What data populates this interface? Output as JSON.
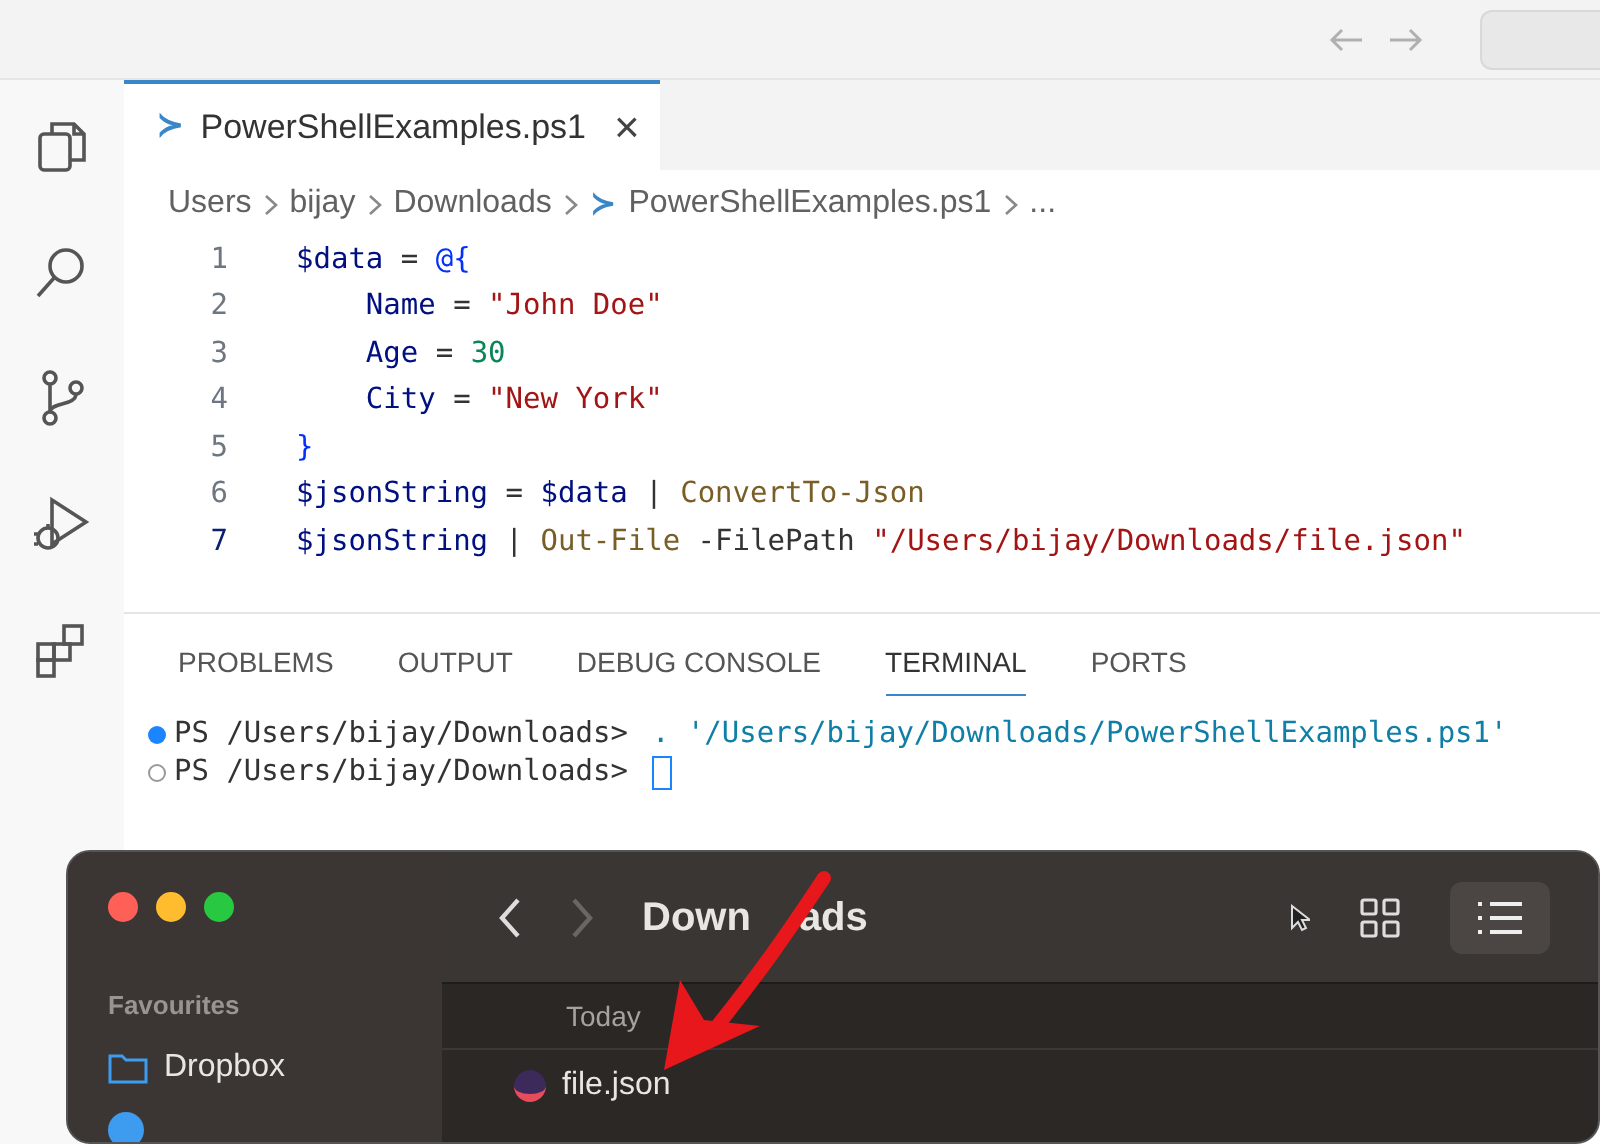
{
  "editor_tab": {
    "icon": "≻",
    "title": "PowerShellExamples.ps1",
    "close": "×"
  },
  "breadcrumbs": [
    {
      "text": "Users"
    },
    {
      "text": "bijay"
    },
    {
      "text": "Downloads"
    },
    {
      "text": "PowerShellExamples.ps1",
      "kind": "file"
    },
    {
      "text": "..."
    }
  ],
  "code_lines": [
    {
      "number": "1",
      "current": false,
      "tokens": [
        {
          "t": "$data",
          "color": "#001080"
        },
        {
          "t": " = ",
          "color": "#333333"
        },
        {
          "t": "@{",
          "color": "#0431fa"
        }
      ]
    },
    {
      "number": "2",
      "current": false,
      "tokens": [
        {
          "t": "    Name",
          "color": "#001080"
        },
        {
          "t": " = ",
          "color": "#333333"
        },
        {
          "t": "\"John Doe\"",
          "color": "#a31515"
        }
      ]
    },
    {
      "number": "3",
      "current": false,
      "tokens": [
        {
          "t": "    Age",
          "color": "#001080"
        },
        {
          "t": " = ",
          "color": "#333333"
        },
        {
          "t": "30",
          "color": "#098658"
        }
      ]
    },
    {
      "number": "4",
      "current": false,
      "tokens": [
        {
          "t": "    City",
          "color": "#001080"
        },
        {
          "t": " = ",
          "color": "#333333"
        },
        {
          "t": "\"New York\"",
          "color": "#a31515"
        }
      ]
    },
    {
      "number": "5",
      "current": false,
      "tokens": [
        {
          "t": "}",
          "color": "#0431fa"
        }
      ]
    },
    {
      "number": "6",
      "current": false,
      "tokens": [
        {
          "t": "$jsonString",
          "color": "#001080"
        },
        {
          "t": " = ",
          "color": "#333333"
        },
        {
          "t": "$data",
          "color": "#001080"
        },
        {
          "t": " | ",
          "color": "#333333"
        },
        {
          "t": "ConvertTo-Json",
          "color": "#795e26"
        }
      ]
    },
    {
      "number": "7",
      "current": true,
      "tokens": [
        {
          "t": "$jsonString",
          "color": "#001080"
        },
        {
          "t": " | ",
          "color": "#333333"
        },
        {
          "t": "Out-File",
          "color": "#795e26"
        },
        {
          "t": " -FilePath ",
          "color": "#333333"
        },
        {
          "t": "\"/Users/bijay/Downloads/file.json\"",
          "color": "#a31515"
        }
      ]
    }
  ],
  "panel_tabs": [
    {
      "label": "PROBLEMS",
      "selected": false
    },
    {
      "label": "OUTPUT",
      "selected": false
    },
    {
      "label": "DEBUG CONSOLE",
      "selected": false
    },
    {
      "label": "TERMINAL",
      "selected": true
    },
    {
      "label": "PORTS",
      "selected": false
    }
  ],
  "terminal_lines": [
    {
      "prompt": "PS /Users/bijay/Downloads>",
      "command": ". '/Users/bijay/Downloads/PowerShellExamples.ps1'",
      "done": true
    },
    {
      "prompt": "PS /Users/bijay/Downloads>",
      "done": false
    }
  ],
  "finder": {
    "title_parts": [
      "Down",
      "ads"
    ],
    "sidebar_heading": "Favourites",
    "sidebar_items": [
      {
        "label": "Dropbox",
        "kind": "folder"
      },
      {
        "kind": "airdrop"
      }
    ],
    "group_heading": "Today",
    "files": [
      {
        "name": "file.json"
      }
    ]
  }
}
